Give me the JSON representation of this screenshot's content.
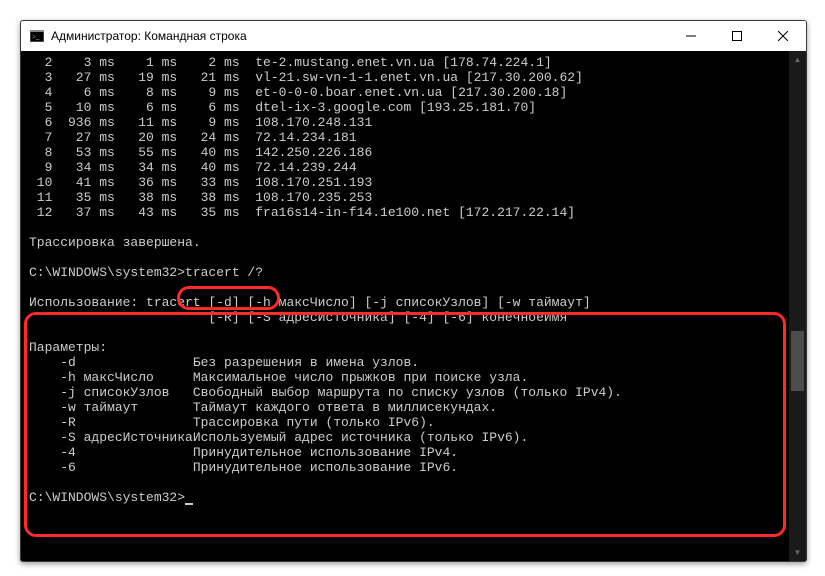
{
  "window": {
    "title": "Администратор: Командная строка"
  },
  "trace": {
    "rows": [
      {
        "hop": "2",
        "t1": "3 ms",
        "t2": "1 ms",
        "t3": "2 ms",
        "host": "te-2.mustang.enet.vn.ua [178.74.224.1]"
      },
      {
        "hop": "3",
        "t1": "27 ms",
        "t2": "19 ms",
        "t3": "21 ms",
        "host": "vl-21.sw-vn-1-1.enet.vn.ua [217.30.200.62]"
      },
      {
        "hop": "4",
        "t1": "6 ms",
        "t2": "8 ms",
        "t3": "9 ms",
        "host": "et-0-0-0.boar.enet.vn.ua [217.30.200.18]"
      },
      {
        "hop": "5",
        "t1": "10 ms",
        "t2": "6 ms",
        "t3": "6 ms",
        "host": "dtel-ix-3.google.com [193.25.181.70]"
      },
      {
        "hop": "6",
        "t1": "936 ms",
        "t2": "11 ms",
        "t3": "9 ms",
        "host": "108.170.248.131"
      },
      {
        "hop": "7",
        "t1": "27 ms",
        "t2": "20 ms",
        "t3": "24 ms",
        "host": "72.14.234.181"
      },
      {
        "hop": "8",
        "t1": "53 ms",
        "t2": "55 ms",
        "t3": "40 ms",
        "host": "142.250.226.186"
      },
      {
        "hop": "9",
        "t1": "34 ms",
        "t2": "34 ms",
        "t3": "40 ms",
        "host": "72.14.239.244"
      },
      {
        "hop": "10",
        "t1": "41 ms",
        "t2": "36 ms",
        "t3": "33 ms",
        "host": "108.170.251.193"
      },
      {
        "hop": "11",
        "t1": "35 ms",
        "t2": "38 ms",
        "t3": "38 ms",
        "host": "108.170.235.253"
      },
      {
        "hop": "12",
        "t1": "37 ms",
        "t2": "43 ms",
        "t3": "35 ms",
        "host": "fra16s14-in-f14.1e100.net [172.217.22.14]"
      }
    ],
    "done": "Трассировка завершена."
  },
  "prompt1": {
    "path": "C:\\WINDOWS\\system32>",
    "cmd": "tracert /?"
  },
  "help": {
    "usage1": "Использование: tracert [-d] [-h максЧисло] [-j списокУзлов] [-w таймаут]",
    "usage2": "                       [-R] [-S адресИсточника] [-4] [-6] конечноеИмя",
    "paramsHeader": "Параметры:",
    "params": [
      {
        "flag": "-d",
        "arg": "",
        "desc": "Без разрешения в имена узлов."
      },
      {
        "flag": "-h",
        "arg": "максЧисло",
        "desc": "Максимальное число прыжков при поиске узла."
      },
      {
        "flag": "-j",
        "arg": "списокУзлов",
        "desc": "Свободный выбор маршрута по списку узлов (только IPv4)."
      },
      {
        "flag": "-w",
        "arg": "таймаут",
        "desc": "Таймаут каждого ответа в миллисекундах."
      },
      {
        "flag": "-R",
        "arg": "",
        "desc": "Трассировка пути (только IPv6)."
      },
      {
        "flag": "-S",
        "arg": "адресИсточника",
        "desc": "Используемый адрес источника (только IPv6)."
      },
      {
        "flag": "-4",
        "arg": "",
        "desc": "Принудительное использование IPv4."
      },
      {
        "flag": "-6",
        "arg": "",
        "desc": "Принудительное использование IPv6."
      }
    ]
  },
  "prompt2": {
    "path": "C:\\WINDOWS\\system32>"
  }
}
